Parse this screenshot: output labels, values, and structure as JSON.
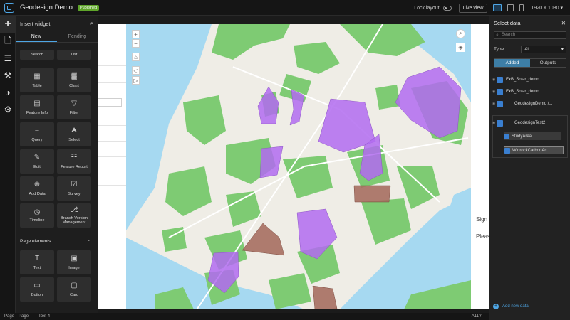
{
  "app": {
    "title": "Geodesign Demo",
    "status_badge": "Published"
  },
  "topbar": {
    "lock_layout_label": "Lock layout",
    "live_view_label": "Live view",
    "resolution": "1920 × 1080",
    "device_icons": [
      "desktop-icon",
      "tablet-icon",
      "phone-icon"
    ]
  },
  "rail": {
    "icons": [
      "plus-icon",
      "page-icon",
      "data-icon",
      "wrench-icon",
      "palette-icon",
      "gear-icon"
    ],
    "help": "?"
  },
  "insert_widget": {
    "title": "Insert widget",
    "tabs": [
      "New",
      "Pending"
    ],
    "top_items": [
      "Search",
      "List"
    ],
    "widgets": [
      {
        "label": "Table",
        "icon": "table-icon"
      },
      {
        "label": "Chart",
        "icon": "chart-icon"
      },
      {
        "label": "Feature Info",
        "icon": "feature-info-icon"
      },
      {
        "label": "Filter",
        "icon": "filter-icon"
      },
      {
        "label": "Query",
        "icon": "query-icon"
      },
      {
        "label": "Select",
        "icon": "select-icon"
      },
      {
        "label": "Edit",
        "icon": "edit-icon"
      },
      {
        "label": "Feature Report",
        "icon": "feature-report-icon"
      },
      {
        "label": "Add Data",
        "icon": "add-data-icon"
      },
      {
        "label": "Survey",
        "icon": "survey-icon"
      },
      {
        "label": "Timeline",
        "icon": "timeline-icon"
      },
      {
        "label": "Branch Version Management",
        "icon": "branch-version-icon"
      }
    ],
    "section_title": "Page elements",
    "page_elements": [
      {
        "label": "Text",
        "icon": "text-icon"
      },
      {
        "label": "Image",
        "icon": "image-icon"
      },
      {
        "label": "Button",
        "icon": "button-icon"
      },
      {
        "label": "Card",
        "icon": "card-icon"
      }
    ]
  },
  "canvas": {
    "right_texts": [
      "Sign",
      "Pleas"
    ]
  },
  "status": {
    "page_label": "Page",
    "page_value": "Page",
    "text_label": "Text 4",
    "right": "A11Y"
  },
  "select_data": {
    "title": "Select data",
    "search_placeholder": "Search",
    "type_label": "Type",
    "type_value": "All",
    "segments": [
      "Added",
      "Outputs"
    ],
    "items": [
      "ExB_Solar_demo",
      "ExB_Solar_demo",
      "GeodesignDemo /..."
    ],
    "group": {
      "name": "GeodesignTest2",
      "children": [
        "StudyArea",
        "WinrockCarbonAc..."
      ]
    },
    "add_new_data": "Add new data"
  }
}
